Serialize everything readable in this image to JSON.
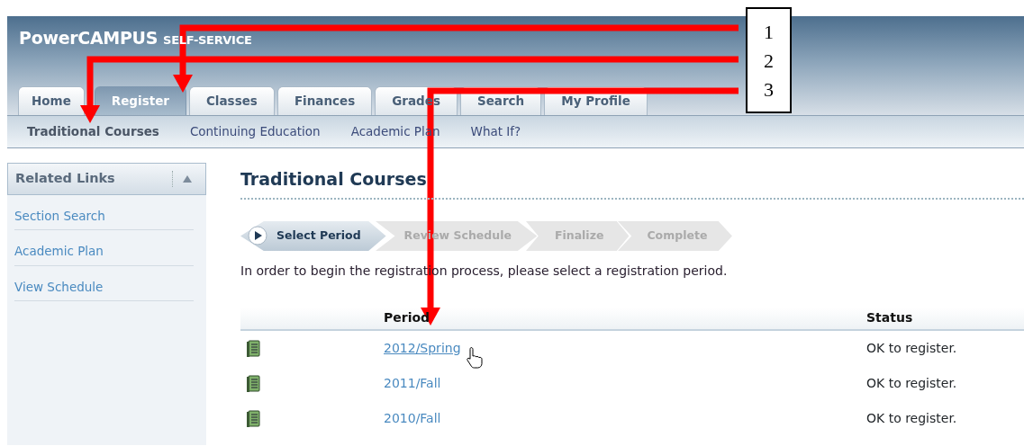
{
  "header": {
    "brand": "PowerCAMPUS",
    "brand_suffix": "SELF-SERVICE"
  },
  "tabs": [
    {
      "label": "Home",
      "selected": false
    },
    {
      "label": "Register",
      "selected": true
    },
    {
      "label": "Classes",
      "selected": false
    },
    {
      "label": "Finances",
      "selected": false
    },
    {
      "label": "Grades",
      "selected": false
    },
    {
      "label": "Search",
      "selected": false
    },
    {
      "label": "My Profile",
      "selected": false
    }
  ],
  "subnav": [
    {
      "label": "Traditional Courses",
      "selected": true
    },
    {
      "label": "Continuing Education",
      "selected": false
    },
    {
      "label": "Academic Plan",
      "selected": false
    },
    {
      "label": "What If?",
      "selected": false
    }
  ],
  "sidebar": {
    "title": "Related Links",
    "expanded": true,
    "items": [
      "Section Search",
      "Academic Plan",
      "View Schedule"
    ]
  },
  "page_title": "Traditional Courses",
  "steps": [
    {
      "label": "Select Period",
      "selected": true
    },
    {
      "label": "Review Schedule",
      "selected": false
    },
    {
      "label": "Finalize",
      "selected": false
    },
    {
      "label": "Complete",
      "selected": false
    }
  ],
  "instruction": "In order to begin the registration process, please select a registration period.",
  "table": {
    "columns": [
      "Period",
      "Status"
    ],
    "rows": [
      {
        "period": "2012/Spring",
        "status": "OK to register.",
        "hovered": true
      },
      {
        "period": "2011/Fall",
        "status": "OK to register.",
        "hovered": false
      },
      {
        "period": "2010/Fall",
        "status": "OK to register.",
        "hovered": false
      }
    ]
  },
  "annotations": {
    "callouts": [
      "1",
      "2",
      "3"
    ]
  }
}
